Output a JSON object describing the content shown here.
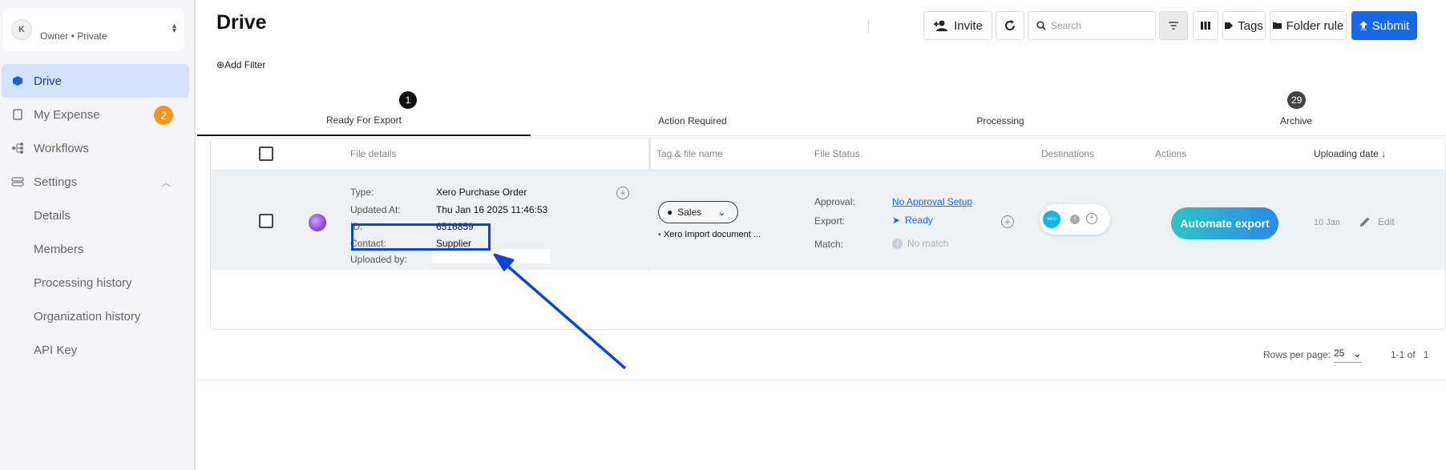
{
  "sidebar": {
    "org": {
      "initial": "K",
      "subtitle": "Owner • Private"
    },
    "items": [
      {
        "label": "Drive"
      },
      {
        "label": "My Expense",
        "badge": "2"
      },
      {
        "label": "Workflows"
      },
      {
        "label": "Settings"
      }
    ],
    "settings_sub": [
      {
        "label": "Details"
      },
      {
        "label": "Members"
      },
      {
        "label": "Processing history"
      },
      {
        "label": "Organization history"
      },
      {
        "label": "API Key"
      }
    ]
  },
  "header": {
    "title": "Drive",
    "add_filter": "Add Filter",
    "toolbar": {
      "invite": "Invite",
      "search_placeholder": "Search",
      "tags": "Tags",
      "folder_rule": "Folder rule",
      "submit": "Submit"
    }
  },
  "tabs": [
    {
      "label": "Ready For Export",
      "badge": "1",
      "active": true
    },
    {
      "label": "Action Required"
    },
    {
      "label": "Processing"
    },
    {
      "label": "Archive",
      "badge": "29"
    }
  ],
  "table": {
    "headers": {
      "file_details": "File details",
      "tag_file_name": "Tag & file name",
      "file_status": "File Status",
      "destinations": "Destinations",
      "actions": "Actions",
      "uploading_date": "Uploading date"
    },
    "row": {
      "details": {
        "type_label": "Type:",
        "type_value": "Xero Purchase Order",
        "updated_label": "Updated At:",
        "updated_value": "Thu Jan 16 2025 11:46:53",
        "id_label": "ID:",
        "id_value": "6516859",
        "contact_label": "Contact:",
        "contact_value": "Supplier",
        "uploaded_label": "Uploaded by:"
      },
      "tag": "Sales",
      "file_name": "Xero Import document ...",
      "status": {
        "approval_label": "Approval:",
        "approval_value": "No Approval Setup",
        "export_label": "Export:",
        "export_value": "Ready",
        "match_label": "Match:",
        "match_value": "No match"
      },
      "destination_logo": "xero",
      "action": "Automate export",
      "date": "10 Jan",
      "edit": "Edit"
    }
  },
  "pagination": {
    "rows_label": "Rows per page:",
    "rows_value": "25",
    "range": "1-1 of",
    "total": "1"
  },
  "colors": {
    "accent": "#1769e8",
    "active_nav_bg": "#d3e3fd",
    "badge_orange": "#f7941d",
    "annotation": "#0a45d6"
  }
}
